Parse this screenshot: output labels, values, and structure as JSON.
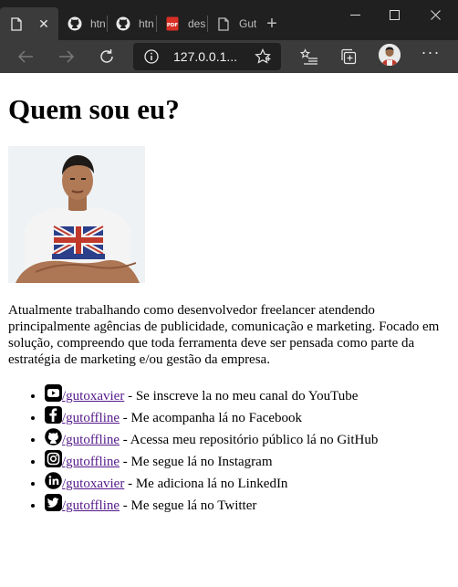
{
  "browser": {
    "tabs": [
      {
        "icon": "page-icon",
        "label": "",
        "active": true
      },
      {
        "icon": "github-icon",
        "label": "htn"
      },
      {
        "icon": "github-icon",
        "label": "htn"
      },
      {
        "icon": "pdf-icon",
        "label": "des"
      },
      {
        "icon": "page-icon",
        "label": "Gut"
      }
    ],
    "address": "127.0.0.1...",
    "colors": {
      "titlebar": "#202020",
      "toolbar": "#3b3b3b",
      "address_bg": "#202020"
    }
  },
  "page": {
    "heading": "Quem sou eu?",
    "photo_alt": "",
    "paragraph": "Atualmente trabalhando como desenvolvedor freelancer atendendo principalmente agências de publicidade, comunicação e marketing. Focado em solução, compreendo que toda ferramenta deve ser pensada como parte da estratégia de marketing e/ou gestão da empresa.",
    "social": [
      {
        "icon": "youtube-icon",
        "handle": "/gutoxavier",
        "text": " - Se inscreve la no meu canal do YouTube"
      },
      {
        "icon": "facebook-icon",
        "handle": "/gutoffline",
        "text": " - Me acompanha lá no Facebook"
      },
      {
        "icon": "github-icon",
        "handle": "/gutoffline",
        "text": " - Acessa meu repositório público lá no GitHub"
      },
      {
        "icon": "instagram-icon",
        "handle": "/gutoffline",
        "text": " - Me segue lá no Instagram"
      },
      {
        "icon": "linkedin-icon",
        "handle": "/gutoxavier",
        "text": " - Me adiciona lá no LinkedIn"
      },
      {
        "icon": "twitter-icon",
        "handle": "/gutoffline",
        "text": " - Me segue lá no Twitter"
      }
    ],
    "link_color": "#551a8b"
  }
}
